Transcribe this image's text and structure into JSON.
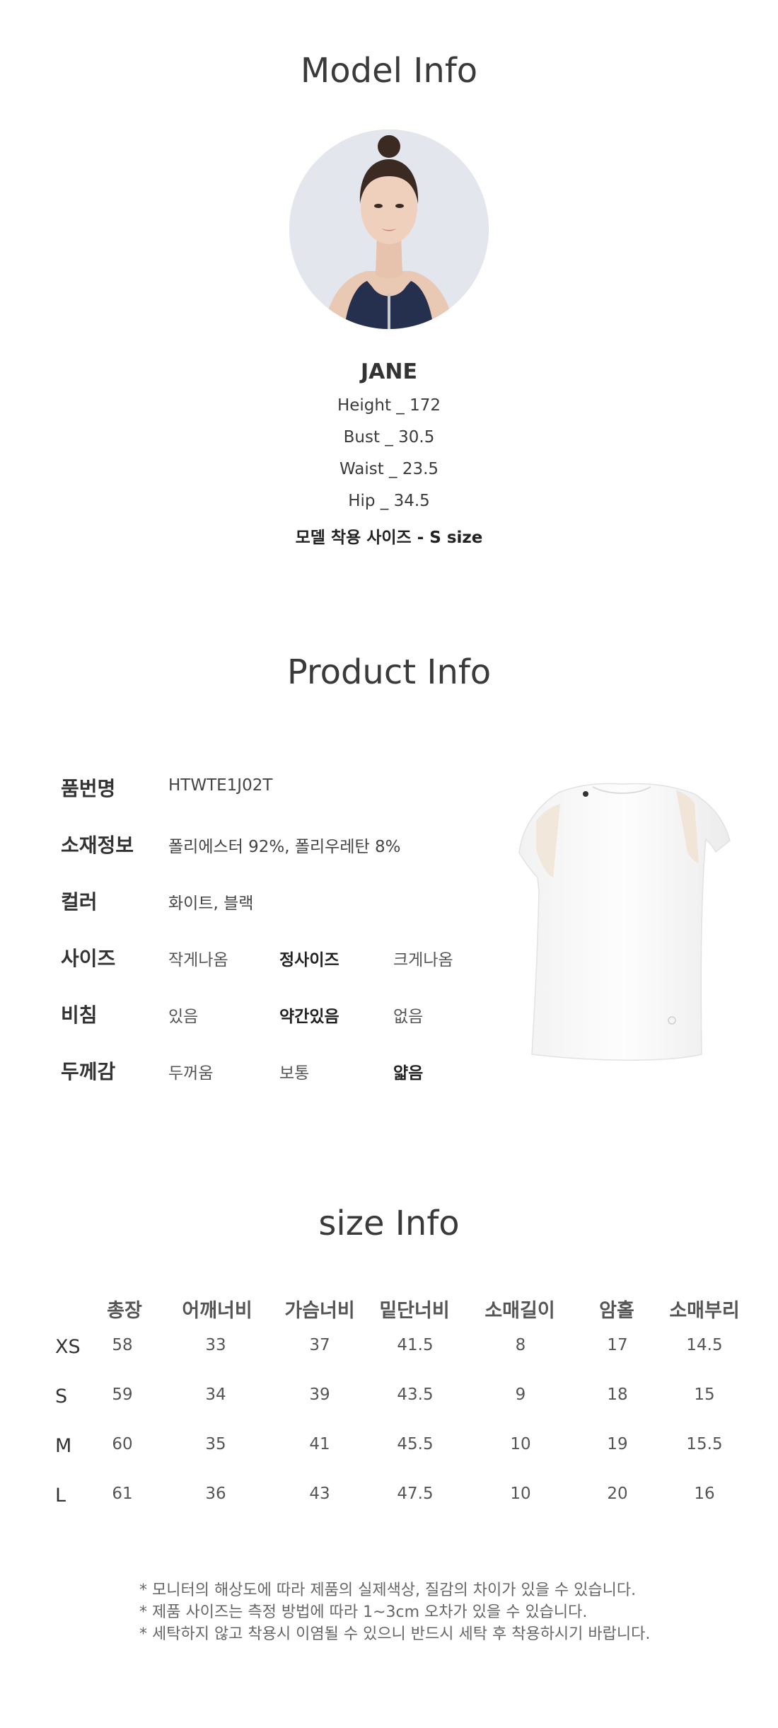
{
  "model_info": {
    "title": "Model Info",
    "name": "JANE",
    "stats": [
      "Height _ 172",
      "Bust _ 30.5",
      "Waist _ 23.5",
      "Hip _ 34.5"
    ],
    "size_note": "모델 착용 사이즈 - S size"
  },
  "product_info": {
    "title": "Product Info",
    "rows": [
      {
        "label": "품번명",
        "value": "HTWTE1J02T"
      },
      {
        "label": "소재정보",
        "value": "폴리에스터 92%, 폴리우레탄 8%"
      },
      {
        "label": "컬러",
        "value": "화이트, 블랙"
      }
    ],
    "scales": [
      {
        "label": "사이즈",
        "options": [
          "작게나옴",
          "정사이즈",
          "크게나옴"
        ],
        "selected": 1
      },
      {
        "label": "비침",
        "options": [
          "있음",
          "약간있음",
          "없음"
        ],
        "selected": 1
      },
      {
        "label": "두께감",
        "options": [
          "두꺼움",
          "보통",
          "얇음"
        ],
        "selected": 2
      }
    ]
  },
  "size_info": {
    "title": "size Info",
    "headers": [
      "총장",
      "어깨너비",
      "가슴너비",
      "밑단너비",
      "소매길이",
      "암홀",
      "소매부리"
    ],
    "rows": [
      {
        "size": "XS",
        "values": [
          "58",
          "33",
          "37",
          "41.5",
          "8",
          "17",
          "14.5"
        ]
      },
      {
        "size": "S",
        "values": [
          "59",
          "34",
          "39",
          "43.5",
          "9",
          "18",
          "15"
        ]
      },
      {
        "size": "M",
        "values": [
          "60",
          "35",
          "41",
          "45.5",
          "10",
          "19",
          "15.5"
        ]
      },
      {
        "size": "L",
        "values": [
          "61",
          "36",
          "43",
          "47.5",
          "10",
          "20",
          "16"
        ]
      }
    ]
  },
  "notes": [
    "* 모니터의 해상도에 따라 제품의 실제색상, 질감의 차이가 있을 수 있습니다.",
    "* 제품 사이즈는 측정 방법에 따라 1~3cm 오차가 있을 수 있습니다.",
    "* 세탁하지 않고 착용시 이염될 수 있으니 반드시 세탁 후 착용하시기 바랍니다."
  ]
}
